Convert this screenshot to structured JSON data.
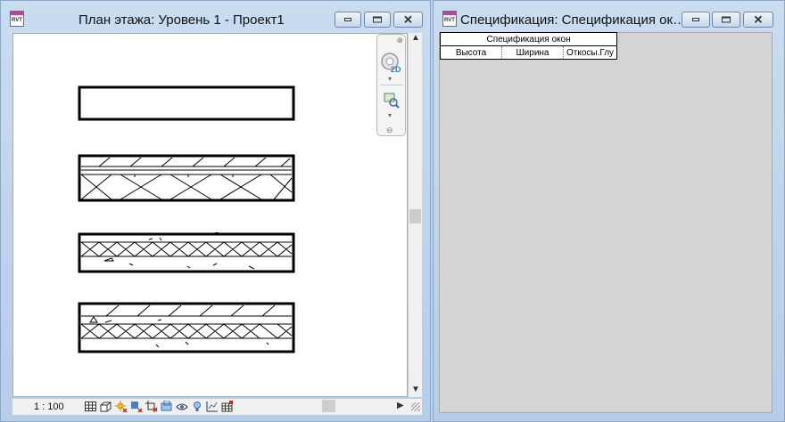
{
  "left_window": {
    "icon_label": "RVT",
    "title": "План этажа: Уровень 1 - Проект1",
    "status": {
      "scale": "1 : 100"
    },
    "status_icons": [
      "detail-level-icon",
      "visual-style-icon",
      "sun-path-icon",
      "shadows-off-icon",
      "crop-view-icon",
      "show-crop-icon",
      "temporary-hide-icon",
      "reveal-hidden-icon",
      "analysis-icon",
      "worksets-icon"
    ],
    "nav_bar": {
      "wheel_label": "2D"
    }
  },
  "right_window": {
    "icon_label": "RVT",
    "title": "Спецификация: Спецификация ок…",
    "schedule": {
      "title": "Спецификация окон",
      "columns": [
        "Высота",
        "Ширина",
        "Откосы.Глу"
      ]
    }
  },
  "colors": {
    "window_frame": "#bcd2ea",
    "sheet_bg": "#d4d4d4",
    "canvas_bg": "#ffffff"
  }
}
